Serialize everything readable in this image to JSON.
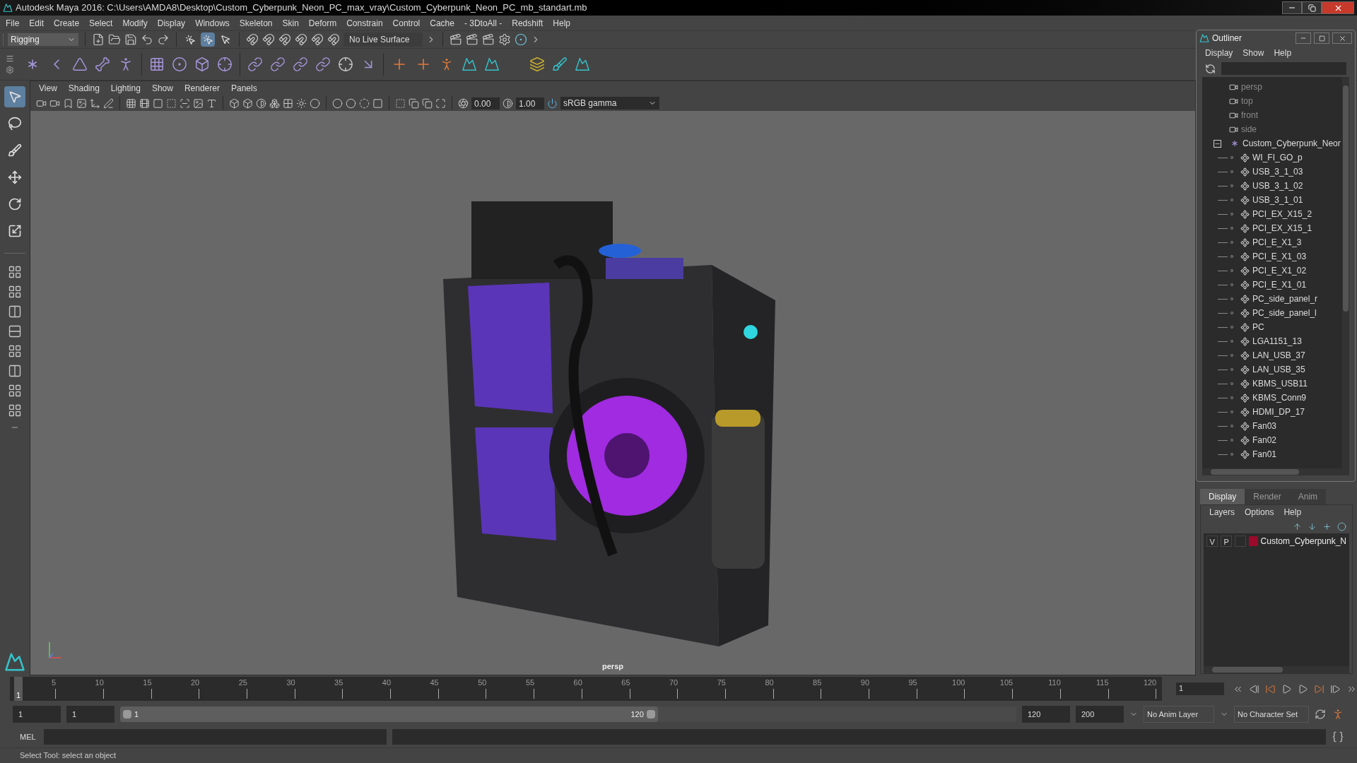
{
  "window": {
    "title": "Autodesk Maya 2016: C:\\Users\\AMDA8\\Desktop\\Custom_Cyberpunk_Neon_PC_max_vray\\Custom_Cyberpunk_Neon_PC_mb_standart.mb"
  },
  "menu": [
    "File",
    "Edit",
    "Create",
    "Select",
    "Modify",
    "Display",
    "Windows",
    "Skeleton",
    "Skin",
    "Deform",
    "Constrain",
    "Control",
    "Cache",
    "- 3DtoAll -",
    "Redshift",
    "Help"
  ],
  "status_line": {
    "mode": "Rigging",
    "live_surface": "No Live Surface",
    "selection_modes": [
      {
        "selected": false
      },
      {
        "selected": true
      },
      {
        "selected": false
      }
    ]
  },
  "toolbox": [
    {
      "selected": true
    },
    {
      "selected": false
    },
    {
      "selected": false
    },
    {
      "selected": false
    },
    {
      "selected": false
    },
    {
      "selected": false
    }
  ],
  "viewport": {
    "menu": [
      "View",
      "Shading",
      "Lighting",
      "Show",
      "Renderer",
      "Panels"
    ],
    "exposure": "0.00",
    "gamma": "1.00",
    "color_space": "sRGB gamma",
    "camera_label": "persp"
  },
  "outliner": {
    "title": "Outliner",
    "menu": [
      "Display",
      "Show",
      "Help"
    ],
    "cameras": [
      "persp",
      "top",
      "front",
      "side"
    ],
    "root": {
      "name": "Custom_Cyberpunk_Neor",
      "expanded": true,
      "children": [
        {
          "name": "WI_FI_GO_p"
        },
        {
          "name": "USB_3_1_03"
        },
        {
          "name": "USB_3_1_02"
        },
        {
          "name": "USB_3_1_01"
        },
        {
          "name": "PCI_EX_X15_2"
        },
        {
          "name": "PCI_EX_X15_1"
        },
        {
          "name": "PCI_E_X1_3"
        },
        {
          "name": "PCI_E_X1_03"
        },
        {
          "name": "PCI_E_X1_02"
        },
        {
          "name": "PCI_E_X1_01"
        },
        {
          "name": "PC_side_panel_r"
        },
        {
          "name": "PC_side_panel_l"
        },
        {
          "name": "PC"
        },
        {
          "name": "LGA1151_13"
        },
        {
          "name": "LAN_USB_37"
        },
        {
          "name": "LAN_USB_35"
        },
        {
          "name": "KBMS_USB11"
        },
        {
          "name": "KBMS_Conn9"
        },
        {
          "name": "HDMI_DP_17"
        },
        {
          "name": "Fan03"
        },
        {
          "name": "Fan02"
        },
        {
          "name": "Fan01"
        }
      ]
    }
  },
  "layer_editor": {
    "tabs": [
      {
        "label": "Display",
        "selected": true
      },
      {
        "label": "Render",
        "selected": false
      },
      {
        "label": "Anim",
        "selected": false
      }
    ],
    "menu": [
      "Layers",
      "Options",
      "Help"
    ],
    "layers": [
      {
        "visibility": "V",
        "playback": "P",
        "color": "#9b0a2a",
        "name": "Custom_Cyberpunk_N"
      }
    ]
  },
  "timeline": {
    "current_frame": "1",
    "ticks": [
      "5",
      "10",
      "15",
      "20",
      "25",
      "30",
      "35",
      "40",
      "45",
      "50",
      "55",
      "60",
      "65",
      "70",
      "75",
      "80",
      "85",
      "90",
      "95",
      "100",
      "105",
      "110",
      "115",
      "120"
    ],
    "frame_field": "1"
  },
  "range": {
    "level": 0.6,
    "start": "1",
    "playback_start": "1",
    "slider_start": "1",
    "slider_end": "120",
    "playback_end": "120",
    "end": "200",
    "anim_layer": "No Anim Layer",
    "character_set": "No Character Set"
  },
  "command_line": {
    "label": "MEL"
  },
  "help_line": "Select Tool: select an object"
}
